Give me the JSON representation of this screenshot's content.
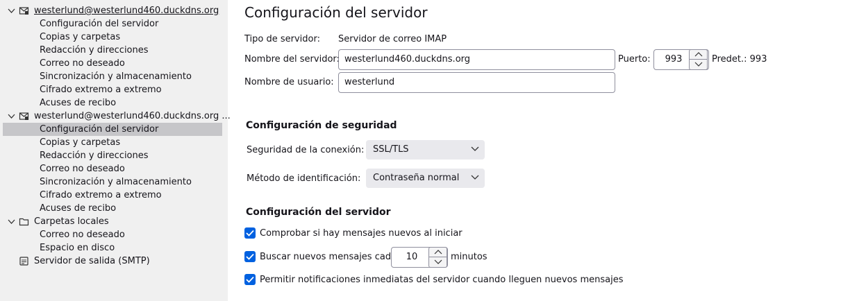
{
  "sidebar": {
    "accounts": [
      {
        "label": "westerlund@westerlund460.duckdns.org",
        "items": [
          "Configuración del servidor",
          "Copias y carpetas",
          "Redacción y direcciones",
          "Correo no deseado",
          "Sincronización y almacenamiento",
          "Cifrado extremo a extremo",
          "Acuses de recibo"
        ]
      },
      {
        "label": "westerlund@westerlund460.duckdns.org ...",
        "items": [
          "Configuración del servidor",
          "Copias y carpetas",
          "Redacción y direcciones",
          "Correo no deseado",
          "Sincronización y almacenamiento",
          "Cifrado extremo a extremo",
          "Acuses de recibo"
        ]
      }
    ],
    "local_folders": {
      "label": "Carpetas locales",
      "items": [
        "Correo no deseado",
        "Espacio en disco"
      ]
    },
    "smtp": {
      "label": "Servidor de salida (SMTP)"
    }
  },
  "main": {
    "title": "Configuración del servidor",
    "server_type_label": "Tipo de servidor:",
    "server_type_value": "Servidor de correo IMAP",
    "server_name_label": "Nombre del servidor:",
    "server_name_value": "westerlund460.duckdns.org",
    "port_label": "Puerto:",
    "port_value": "993",
    "port_default": "Predet.: 993",
    "username_label": "Nombre de usuario:",
    "username_value": "westerlund",
    "security": {
      "title": "Configuración de seguridad",
      "connection_label": "Seguridad de la conexión:",
      "connection_value": "SSL/TLS",
      "auth_label": "Método de identificación:",
      "auth_value": "Contraseña normal"
    },
    "server_settings": {
      "title": "Configuración del servidor",
      "check_startup_label": "Comprobar si hay mensajes nuevos al iniciar",
      "check_every_label": "Buscar nuevos mensajes cada",
      "check_every_value": "10",
      "minutes_label": "minutos",
      "push_label": "Permitir notificaciones inmediatas del servidor cuando lleguen nuevos mensajes"
    }
  },
  "colors": {
    "accent": "#0061e0",
    "sidebar_bg": "#f0f0f0",
    "selected_bg": "#c6c6c9"
  }
}
